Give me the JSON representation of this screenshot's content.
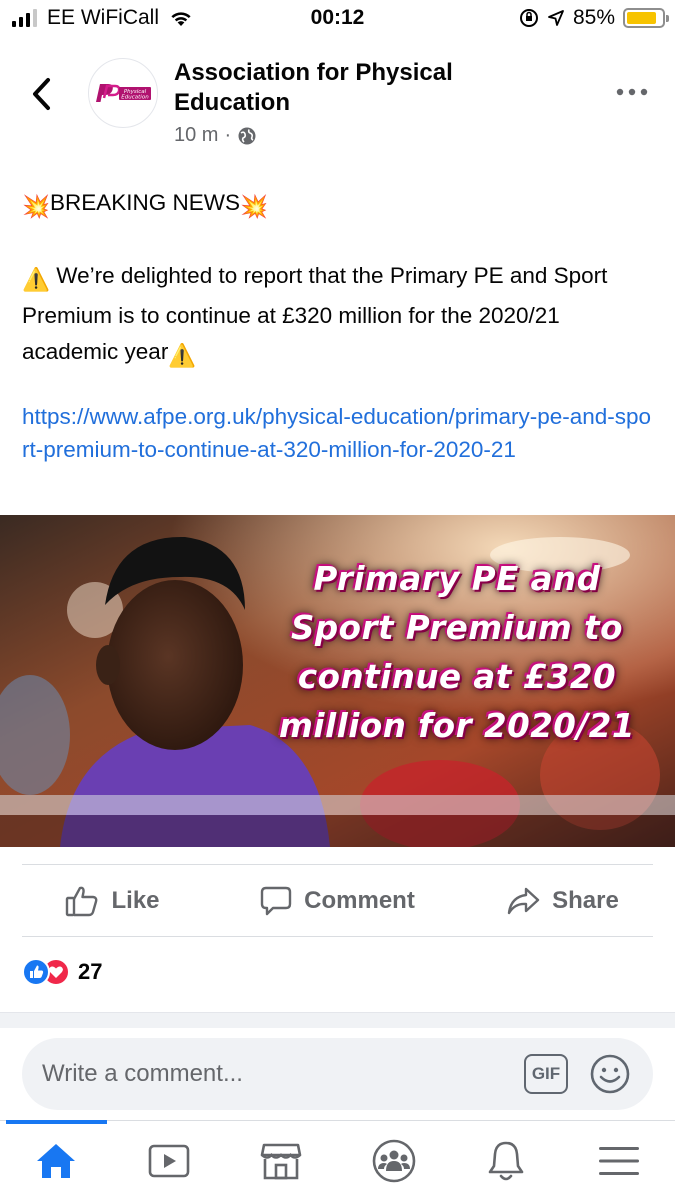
{
  "status_bar": {
    "carrier": "EE WiFiCall",
    "time": "00:12",
    "battery_percent": "85%",
    "battery_level": 0.85,
    "battery_color": "#f7c300"
  },
  "post": {
    "page_name": "Association for Physical Education",
    "avatar_logo_text": "Physical Education",
    "time_ago": "10 m",
    "separator": "·",
    "audience_icon": "globe-icon",
    "breaking_emoji_left": "💥",
    "breaking_text": "BREAKING NEWS",
    "breaking_emoji_right": "💥",
    "warning_emoji": "⚠️",
    "body_text": "We’re delighted to report that the Primary PE and Sport Premium is to continue at £320 million for the 2020/21 academic year",
    "link": "https://www.afpe.org.uk/physical-education/primary-pe-and-sport-premium-to-continue-at-320-million-for-2020-21",
    "image_headline": "Primary PE and Sport Premium to continue at £320 million for 2020/21"
  },
  "actions": {
    "like_label": "Like",
    "comment_label": "Comment",
    "share_label": "Share"
  },
  "reactions": {
    "count": "27",
    "types": [
      "like",
      "love"
    ]
  },
  "composer": {
    "placeholder": "Write a comment...",
    "gif_label": "GIF"
  },
  "tabbar": {
    "tabs": [
      "home",
      "watch",
      "marketplace",
      "groups",
      "notifications",
      "menu"
    ],
    "active": "home"
  },
  "colors": {
    "accent": "#1877f2",
    "link": "#216fdb",
    "love": "#f0284a",
    "secondary_text": "#65676b"
  }
}
